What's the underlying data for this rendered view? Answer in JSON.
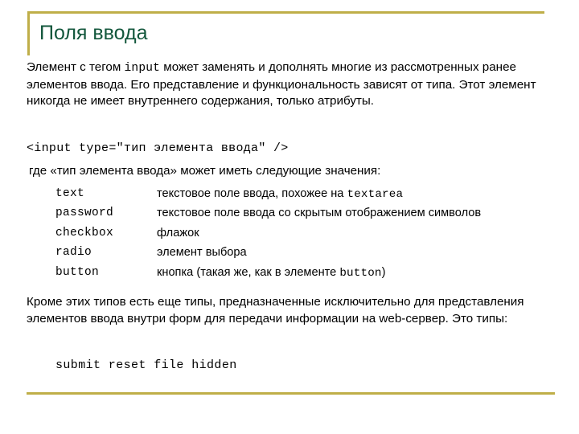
{
  "slide": {
    "title": "Поля ввода",
    "accent_color": "#bfae48",
    "title_color": "#13573c",
    "background_color": "#ffffff",
    "text_color": "#000000"
  },
  "intro": {
    "part1": "Элемент с тегом ",
    "tag": "input",
    "part2": " может заменять и дополнять многие из рассмотренных ранее элементов ввода. Его представление и функциональность зависят от типа. Этот элемент никогда не имеет внутреннего содержания, только атрибуты."
  },
  "code_sample": "<input type=\"тип элемента ввода\" />",
  "where_line": "где «тип элемента ввода» может иметь следующие значения:",
  "types_table": {
    "rows": [
      {
        "type": "text",
        "desc_before": "текстовое поле ввода, похожее на ",
        "desc_mono": "textarea",
        "desc_after": ""
      },
      {
        "type": "password",
        "desc_before": "текстовое поле ввода со скрытым отображением символов",
        "desc_mono": "",
        "desc_after": ""
      },
      {
        "type": "checkbox",
        "desc_before": "флажок",
        "desc_mono": "",
        "desc_after": ""
      },
      {
        "type": "radio",
        "desc_before": "элемент выбора",
        "desc_mono": "",
        "desc_after": ""
      },
      {
        "type": "button",
        "desc_before": "кнопка (такая же, как в элементе ",
        "desc_mono": "button",
        "desc_after": ")"
      }
    ]
  },
  "extra_paragraph": "Кроме этих типов есть еще типы, предназначенные исключительно для представления элементов ввода внутри форм для передачи информации на web-сервер. Это типы:",
  "form_types": "submit reset file hidden"
}
